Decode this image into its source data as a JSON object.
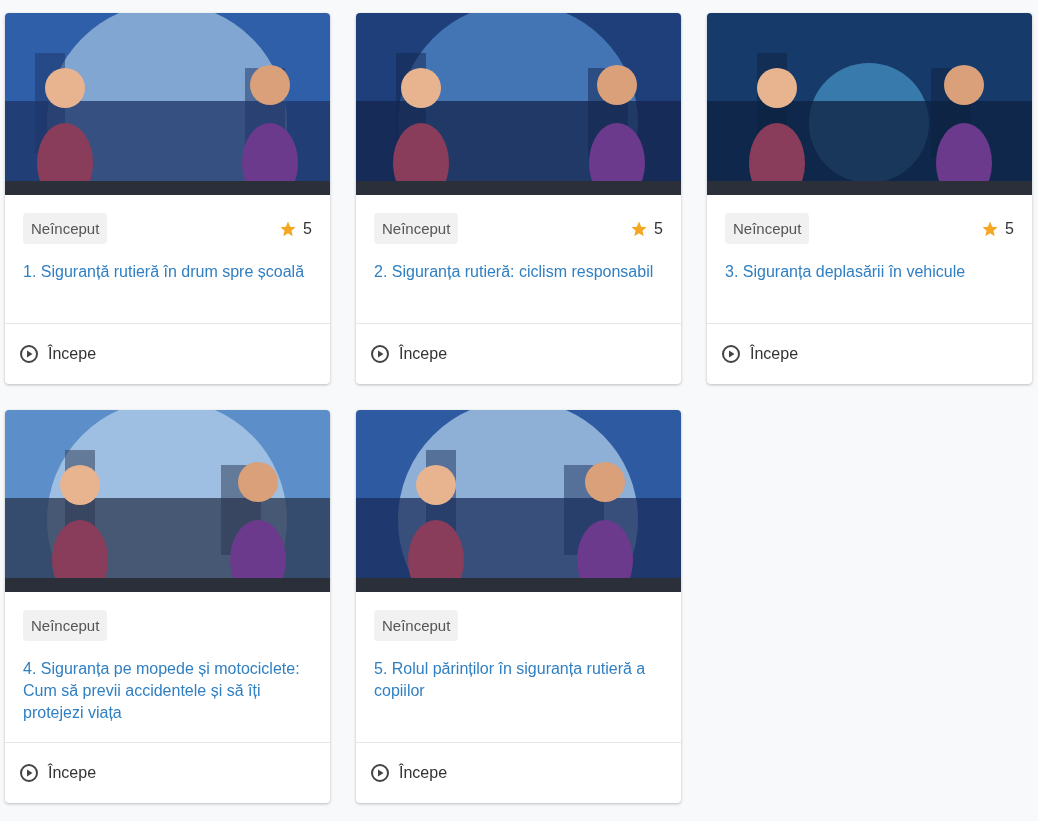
{
  "courses": [
    {
      "status": "Neînceput",
      "rating": "5",
      "title": "1. Siguranță rutieră în drum spre școală",
      "action": "Începe"
    },
    {
      "status": "Neînceput",
      "rating": "5",
      "title": "2. Siguranța rutieră: ciclism responsabil",
      "action": "Începe"
    },
    {
      "status": "Neînceput",
      "rating": "5",
      "title": "3. Siguranța deplasării în vehicule",
      "action": "Începe"
    },
    {
      "status": "Neînceput",
      "title": "4. Siguranța pe mopede și motociclete: Cum să previi accidentele și să îți protejezi viața",
      "action": "Începe"
    },
    {
      "status": "Neînceput",
      "title": "5. Rolul părinților în siguranța rutieră a copiilor",
      "action": "Începe"
    }
  ]
}
